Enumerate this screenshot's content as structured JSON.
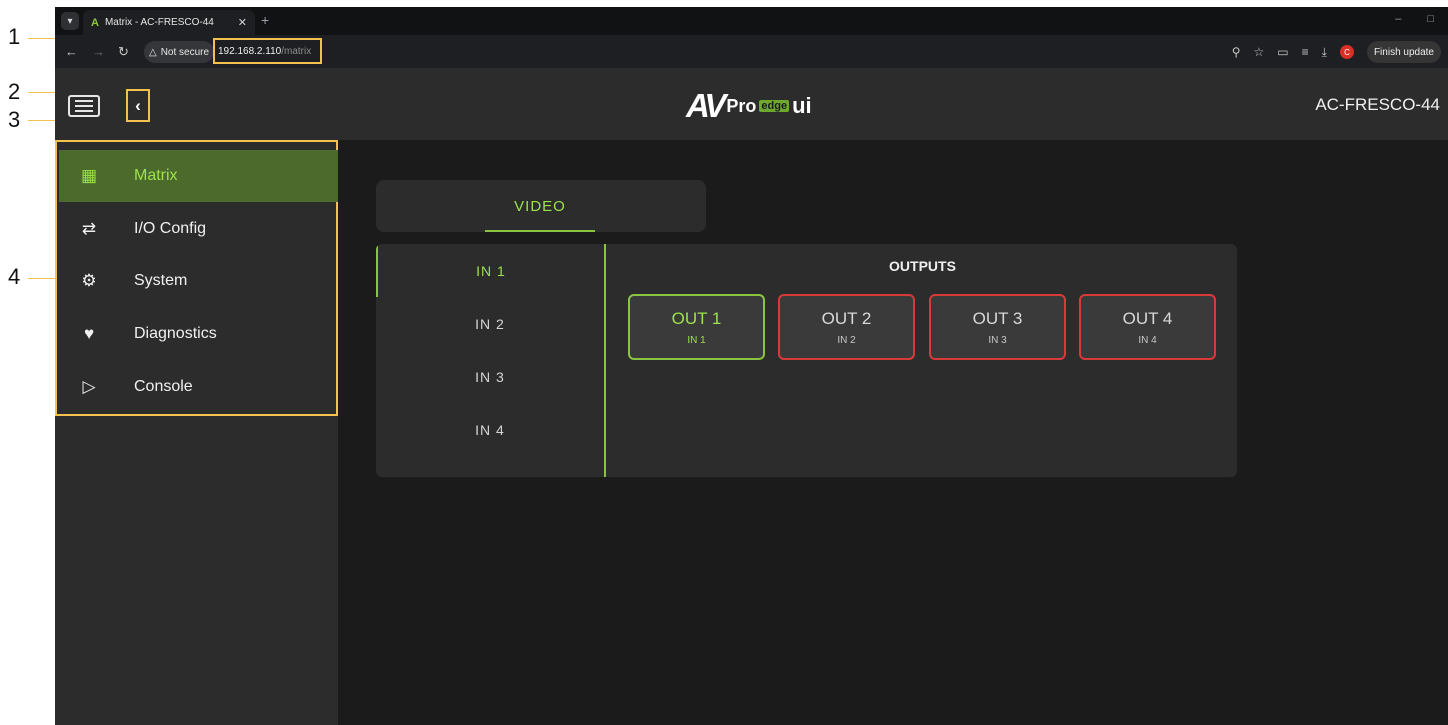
{
  "callouts": [
    "1",
    "2",
    "3",
    "4"
  ],
  "browser": {
    "tab_title": "Matrix - AC-FRESCO-44",
    "tab_favicon": "A",
    "security_label": "Not secure",
    "url_host": "192.168.2.110",
    "url_path": "/matrix",
    "finish_update_label": "Finish update",
    "profile_initial": "C",
    "icons": [
      "chevron-down-icon",
      "back-icon",
      "forward-icon",
      "reload-icon",
      "warning-icon",
      "zoom-icon",
      "star-icon",
      "extensions-icon",
      "media-icon",
      "download-icon",
      "minimize-icon",
      "maximize-icon",
      "close-icon",
      "new-tab-icon"
    ]
  },
  "app": {
    "logo": {
      "av": "AV",
      "pro": "Pro",
      "edge": "edge",
      "ui": "ui"
    },
    "device_name": "AC-FRESCO-44",
    "accent_color": "#8bc53f",
    "error_color": "#d83a3a"
  },
  "sidebar": {
    "items": [
      {
        "label": "Matrix",
        "icon": "grid-icon",
        "active": true
      },
      {
        "label": "I/O Config",
        "icon": "swap-arrows-icon",
        "active": false
      },
      {
        "label": "System",
        "icon": "gear-icon",
        "active": false
      },
      {
        "label": "Diagnostics",
        "icon": "heart-pulse-icon",
        "active": false
      },
      {
        "label": "Console",
        "icon": "terminal-icon",
        "active": false
      }
    ]
  },
  "main": {
    "tabs": [
      {
        "label": "VIDEO",
        "active": true
      }
    ],
    "inputs": [
      {
        "label": "IN 1",
        "active": true
      },
      {
        "label": "IN 2",
        "active": false
      },
      {
        "label": "IN 3",
        "active": false
      },
      {
        "label": "IN 4",
        "active": false
      }
    ],
    "outputs_title": "OUTPUTS",
    "outputs": [
      {
        "name": "OUT 1",
        "source": "IN 1",
        "active": true
      },
      {
        "name": "OUT 2",
        "source": "IN 2",
        "active": false
      },
      {
        "name": "OUT 3",
        "source": "IN 3",
        "active": false
      },
      {
        "name": "OUT 4",
        "source": "IN 4",
        "active": false
      }
    ]
  }
}
